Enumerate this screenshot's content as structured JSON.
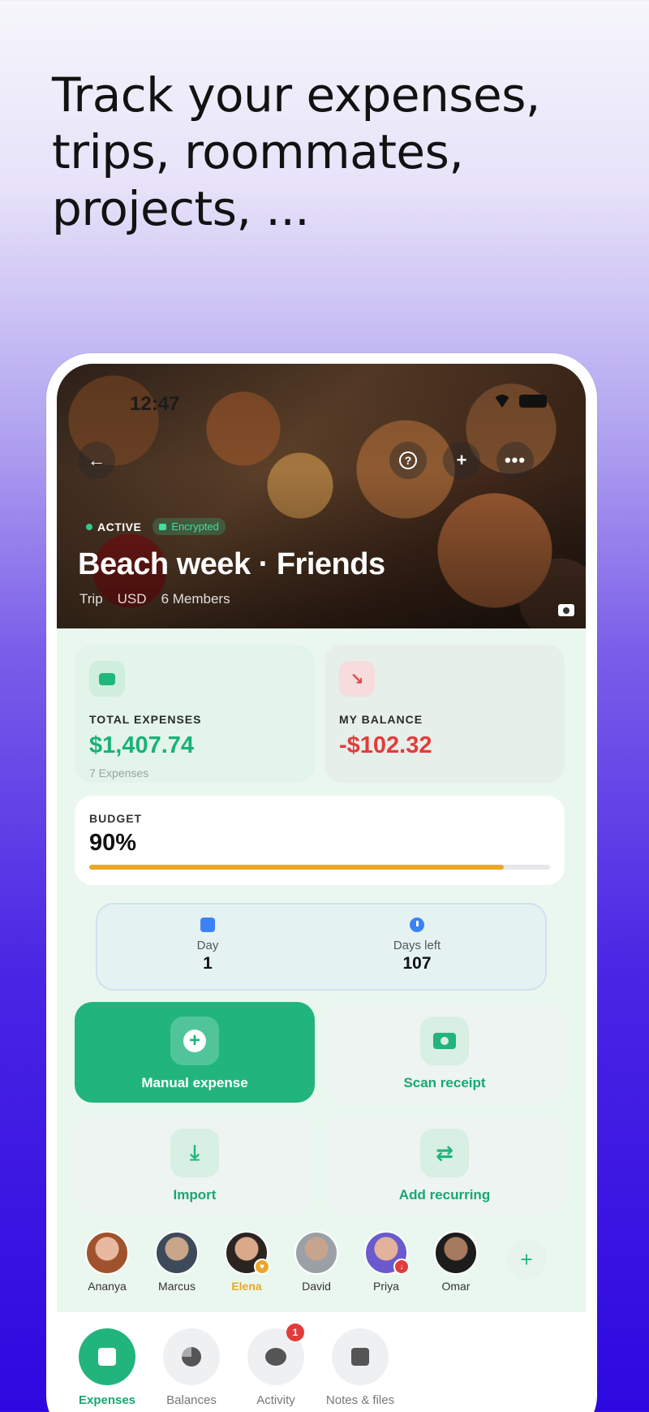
{
  "headline": "Track your expenses, trips, roommates, projects, ...",
  "status": {
    "time": "12:47"
  },
  "header": {
    "status_badge": "ACTIVE",
    "encrypted_badge": "Encrypted",
    "title": "Beach week · Friends",
    "meta": {
      "type": "Trip",
      "currency": "USD",
      "members": "6 Members"
    }
  },
  "stats": {
    "total": {
      "label": "TOTAL EXPENSES",
      "value": "$1,407.74",
      "sub": "7 Expenses"
    },
    "balance": {
      "label": "MY BALANCE",
      "value": "-$102.32"
    }
  },
  "budget": {
    "label": "BUDGET",
    "value": "90%",
    "fraction": 0.9
  },
  "days": {
    "day": {
      "label": "Day",
      "value": "1"
    },
    "left": {
      "label": "Days left",
      "value": "107"
    }
  },
  "actions": {
    "manual": "Manual expense",
    "scan": "Scan receipt",
    "import": "Import",
    "recurring": "Add recurring"
  },
  "members": [
    {
      "name": "Ananya"
    },
    {
      "name": "Marcus"
    },
    {
      "name": "Elena"
    },
    {
      "name": "David"
    },
    {
      "name": "Priya"
    },
    {
      "name": "Omar"
    }
  ],
  "nav": {
    "expenses": "Expenses",
    "balances": "Balances",
    "activity": "Activity",
    "activity_badge": "1",
    "notes": "Notes & files"
  },
  "colors": {
    "accent": "#21b57d",
    "negative": "#e23b3b",
    "budget": "#e9a72a"
  }
}
